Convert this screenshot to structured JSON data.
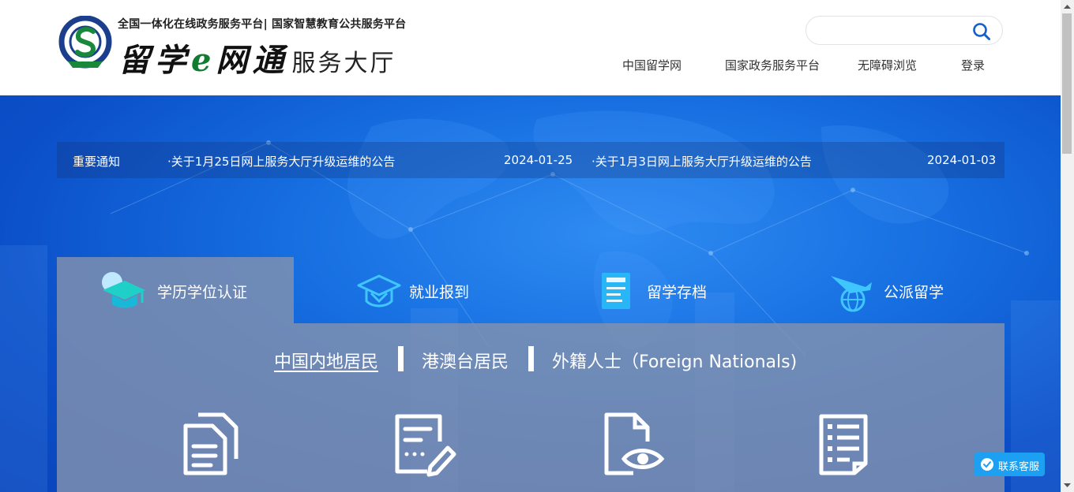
{
  "header": {
    "tagline": "全国一体化在线政务服务平台| 国家智慧教育公共服务平台",
    "brand_a": "留学",
    "brand_e": "e",
    "brand_b": "网通",
    "brand_suffix": "服务大厅",
    "search": {
      "value": "",
      "placeholder": "",
      "icon": "search-icon"
    },
    "nav": [
      "中国留学网",
      "国家政务服务平台",
      "无障碍浏览",
      "登录"
    ]
  },
  "notices": {
    "label": "重要通知",
    "items": [
      {
        "bullet": "·",
        "title": "关于1月25日网上服务大厅升级运维的公告",
        "date": "2024-01-25"
      },
      {
        "bullet": "·",
        "title": "关于1月3日网上服务大厅升级运维的公告",
        "date": "2024-01-03"
      }
    ]
  },
  "main_tabs": [
    {
      "label": "学历学位认证",
      "icon": "graduation-cap-icon",
      "active": true
    },
    {
      "label": "就业报到",
      "icon": "mortarboard-icon",
      "active": false
    },
    {
      "label": "留学存档",
      "icon": "archive-document-icon",
      "active": false
    },
    {
      "label": "公派留学",
      "icon": "plane-globe-icon",
      "active": false
    }
  ],
  "sub_tabs": [
    {
      "label": "中国内地居民",
      "active": true
    },
    {
      "label": "港澳台居民",
      "active": false
    },
    {
      "label": "外籍人士（Foreign Nationals)",
      "active": false
    }
  ],
  "service_icons": [
    "documents-icon",
    "form-edit-icon",
    "file-view-icon",
    "checklist-icon"
  ],
  "customer_service": {
    "label": "联系客服",
    "icon": "chat-check-icon"
  },
  "colors": {
    "hero_blue": "#166ee0",
    "panel_gray": "#828faf",
    "accent_cyan": "#1ea0f2",
    "brand_green": "#137a31"
  }
}
